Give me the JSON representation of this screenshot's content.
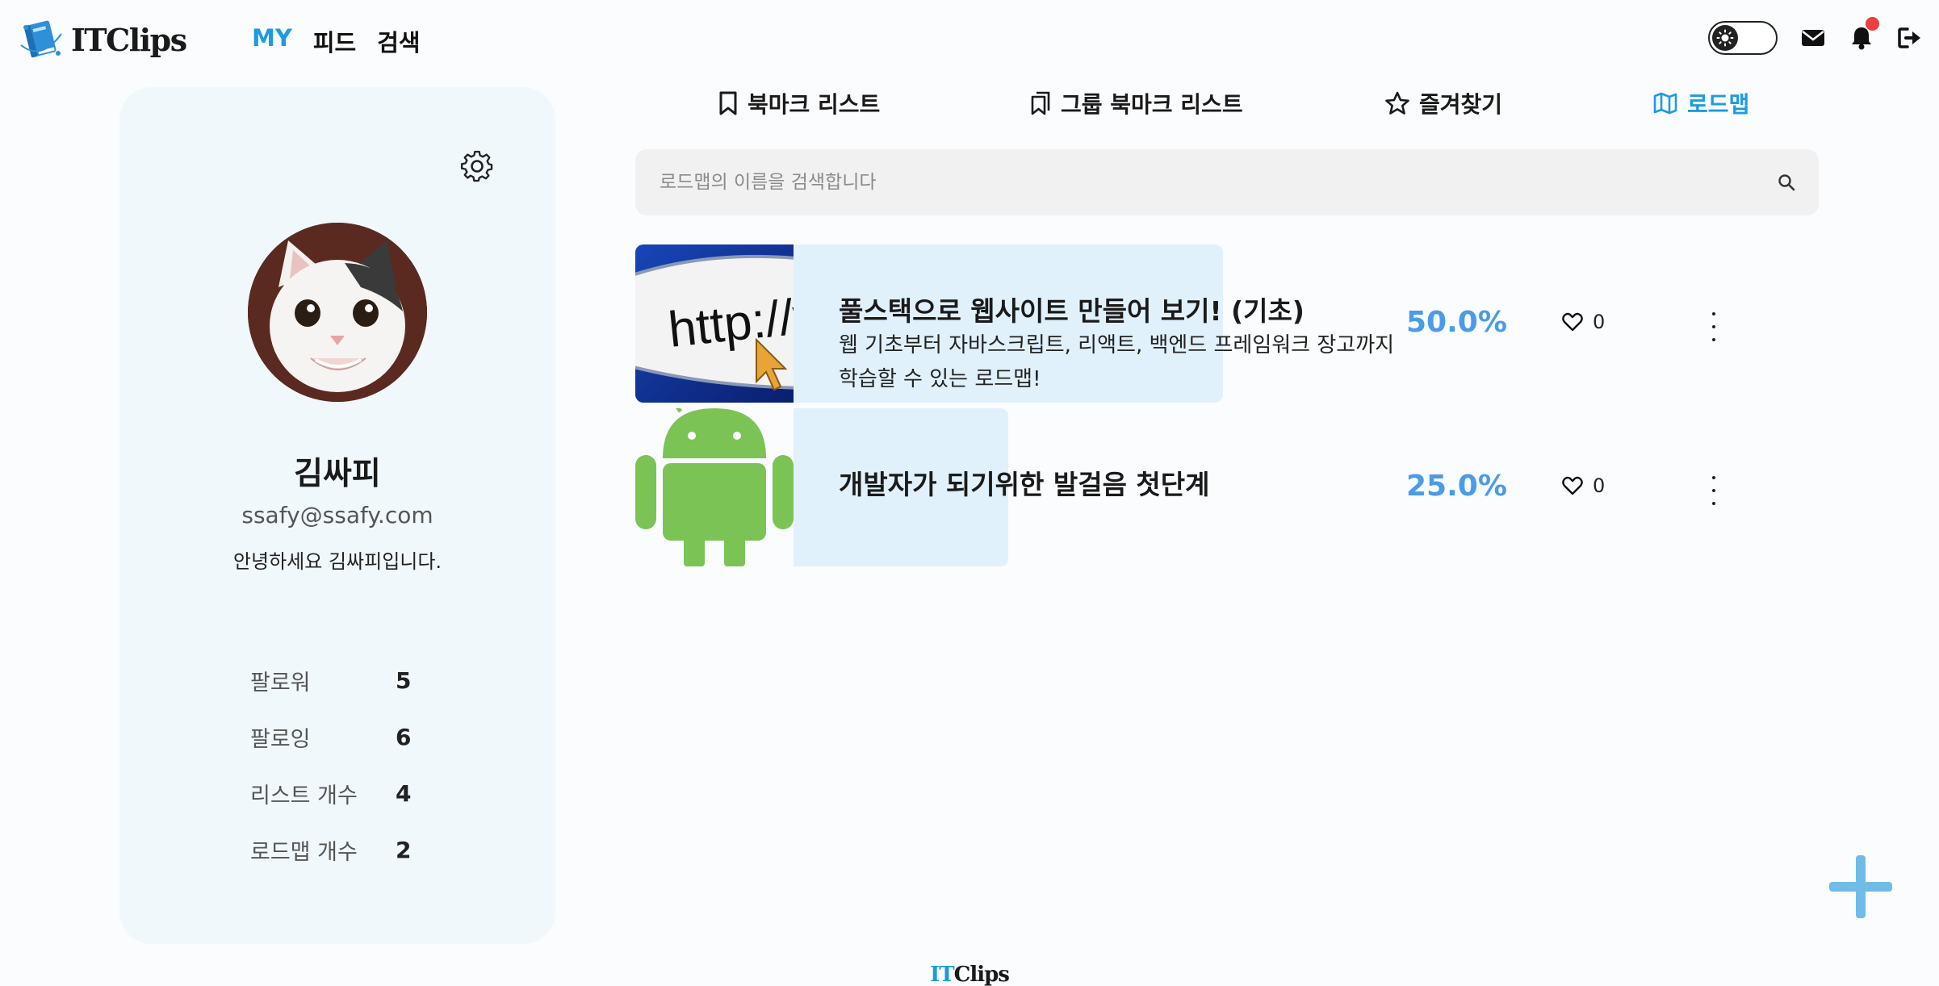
{
  "app": {
    "logo_text": "ITClips"
  },
  "nav": {
    "items": [
      {
        "label": "MY",
        "active": true
      },
      {
        "label": "피드",
        "active": false
      },
      {
        "label": "검색",
        "active": false
      }
    ]
  },
  "header_icons": [
    "theme-toggle",
    "mail-icon",
    "bell-icon",
    "logout-icon"
  ],
  "profile": {
    "name": "김싸피",
    "email": "ssafy@ssafy.com",
    "bio": "안녕하세요 김싸피입니다.",
    "stats": [
      {
        "label": "팔로워",
        "value": "5"
      },
      {
        "label": "팔로잉",
        "value": "6"
      },
      {
        "label": "리스트 개수",
        "value": "4"
      },
      {
        "label": "로드맵 개수",
        "value": "2"
      }
    ]
  },
  "tabs": [
    {
      "label": "북마크 리스트",
      "icon": "bookmark-icon",
      "active": false
    },
    {
      "label": "그룹 북마크 리스트",
      "icon": "group-bookmark-icon",
      "active": false
    },
    {
      "label": "즐겨찾기",
      "icon": "star-icon",
      "active": false
    },
    {
      "label": "로드맵",
      "icon": "map-icon",
      "active": true
    }
  ],
  "search": {
    "placeholder": "로드맵의 이름을 검색합니다",
    "value": ""
  },
  "roadmaps": [
    {
      "title": "풀스택으로 웹사이트 만들어 보기! (기초)",
      "description": "웹 기초부터 자바스크립트, 리액트, 백엔드 프레임워크 장고까지 학습할 수 있는 로드맵!",
      "progress_label": "50.0%",
      "progress": 0.5,
      "likes": "0",
      "thumbnail": "http-url-image"
    },
    {
      "title": "개발자가 되기위한 발걸음 첫단계",
      "description": "",
      "progress_label": "25.0%",
      "progress": 0.25,
      "likes": "0",
      "thumbnail": "android-robot-image"
    }
  ],
  "footer": {
    "logo_it": "IT",
    "logo_rest": "Clips"
  },
  "colors": {
    "accent": "#1c9be0",
    "percent": "#4a9be8",
    "progress_fill": "#e0f1fc",
    "card_bg": "#f1f8fc",
    "notification_dot": "#ec3f3f"
  }
}
